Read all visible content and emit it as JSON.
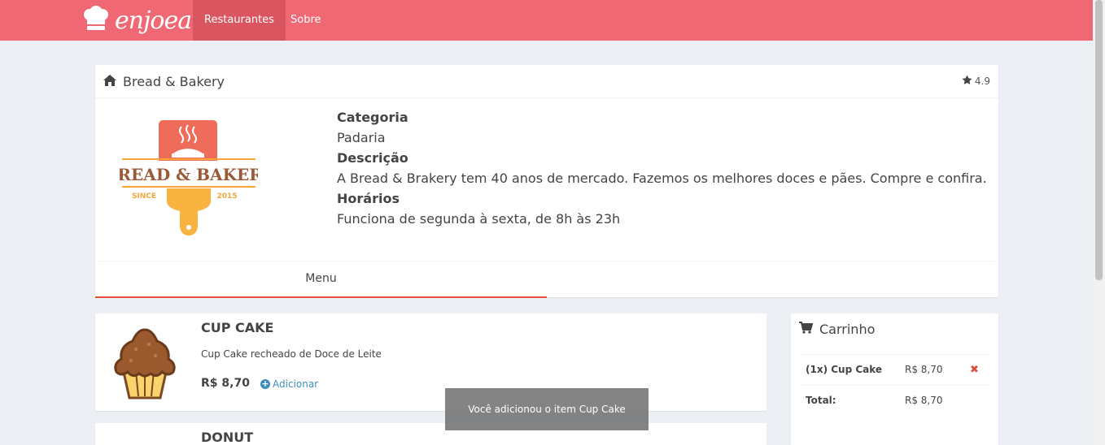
{
  "navbar": {
    "brand": "enjoeat",
    "items": [
      {
        "label": "Restaurantes"
      },
      {
        "label": "Sobre"
      }
    ]
  },
  "restaurant": {
    "name": "Bread & Bakery",
    "rating": "4.9",
    "logo": {
      "title": "BREAD & BAKERY",
      "since": "SINCE",
      "year": "2015"
    },
    "category_label": "Categoria",
    "category": "Padaria",
    "description_label": "Descrição",
    "description": "A Bread & Brakery tem 40 anos de mercado. Fazemos os melhores doces e pães. Compre e confira.",
    "hours_label": "Horários",
    "hours": "Funciona de segunda à sexta, de 8h às 23h"
  },
  "tabs": [
    {
      "label": "Menu"
    }
  ],
  "menu_items": [
    {
      "name": "CUP CAKE",
      "description": "Cup Cake recheado de Doce de Leite",
      "price": "R$ 8,70",
      "add_label": "Adicionar"
    },
    {
      "name": "DONUT"
    }
  ],
  "cart": {
    "title": "Carrinho",
    "rows": [
      {
        "item": "(1x) Cup Cake",
        "price": "R$ 8,70",
        "remove": "✖"
      },
      {
        "item": "Total:",
        "price": "R$ 8,70"
      }
    ]
  },
  "toast": "Você adicionou o item Cup Cake",
  "colors": {
    "navbar": "#f06874",
    "navbar_active": "#d9555f",
    "accent": "#e74c3c",
    "link": "#3c8dbc"
  }
}
